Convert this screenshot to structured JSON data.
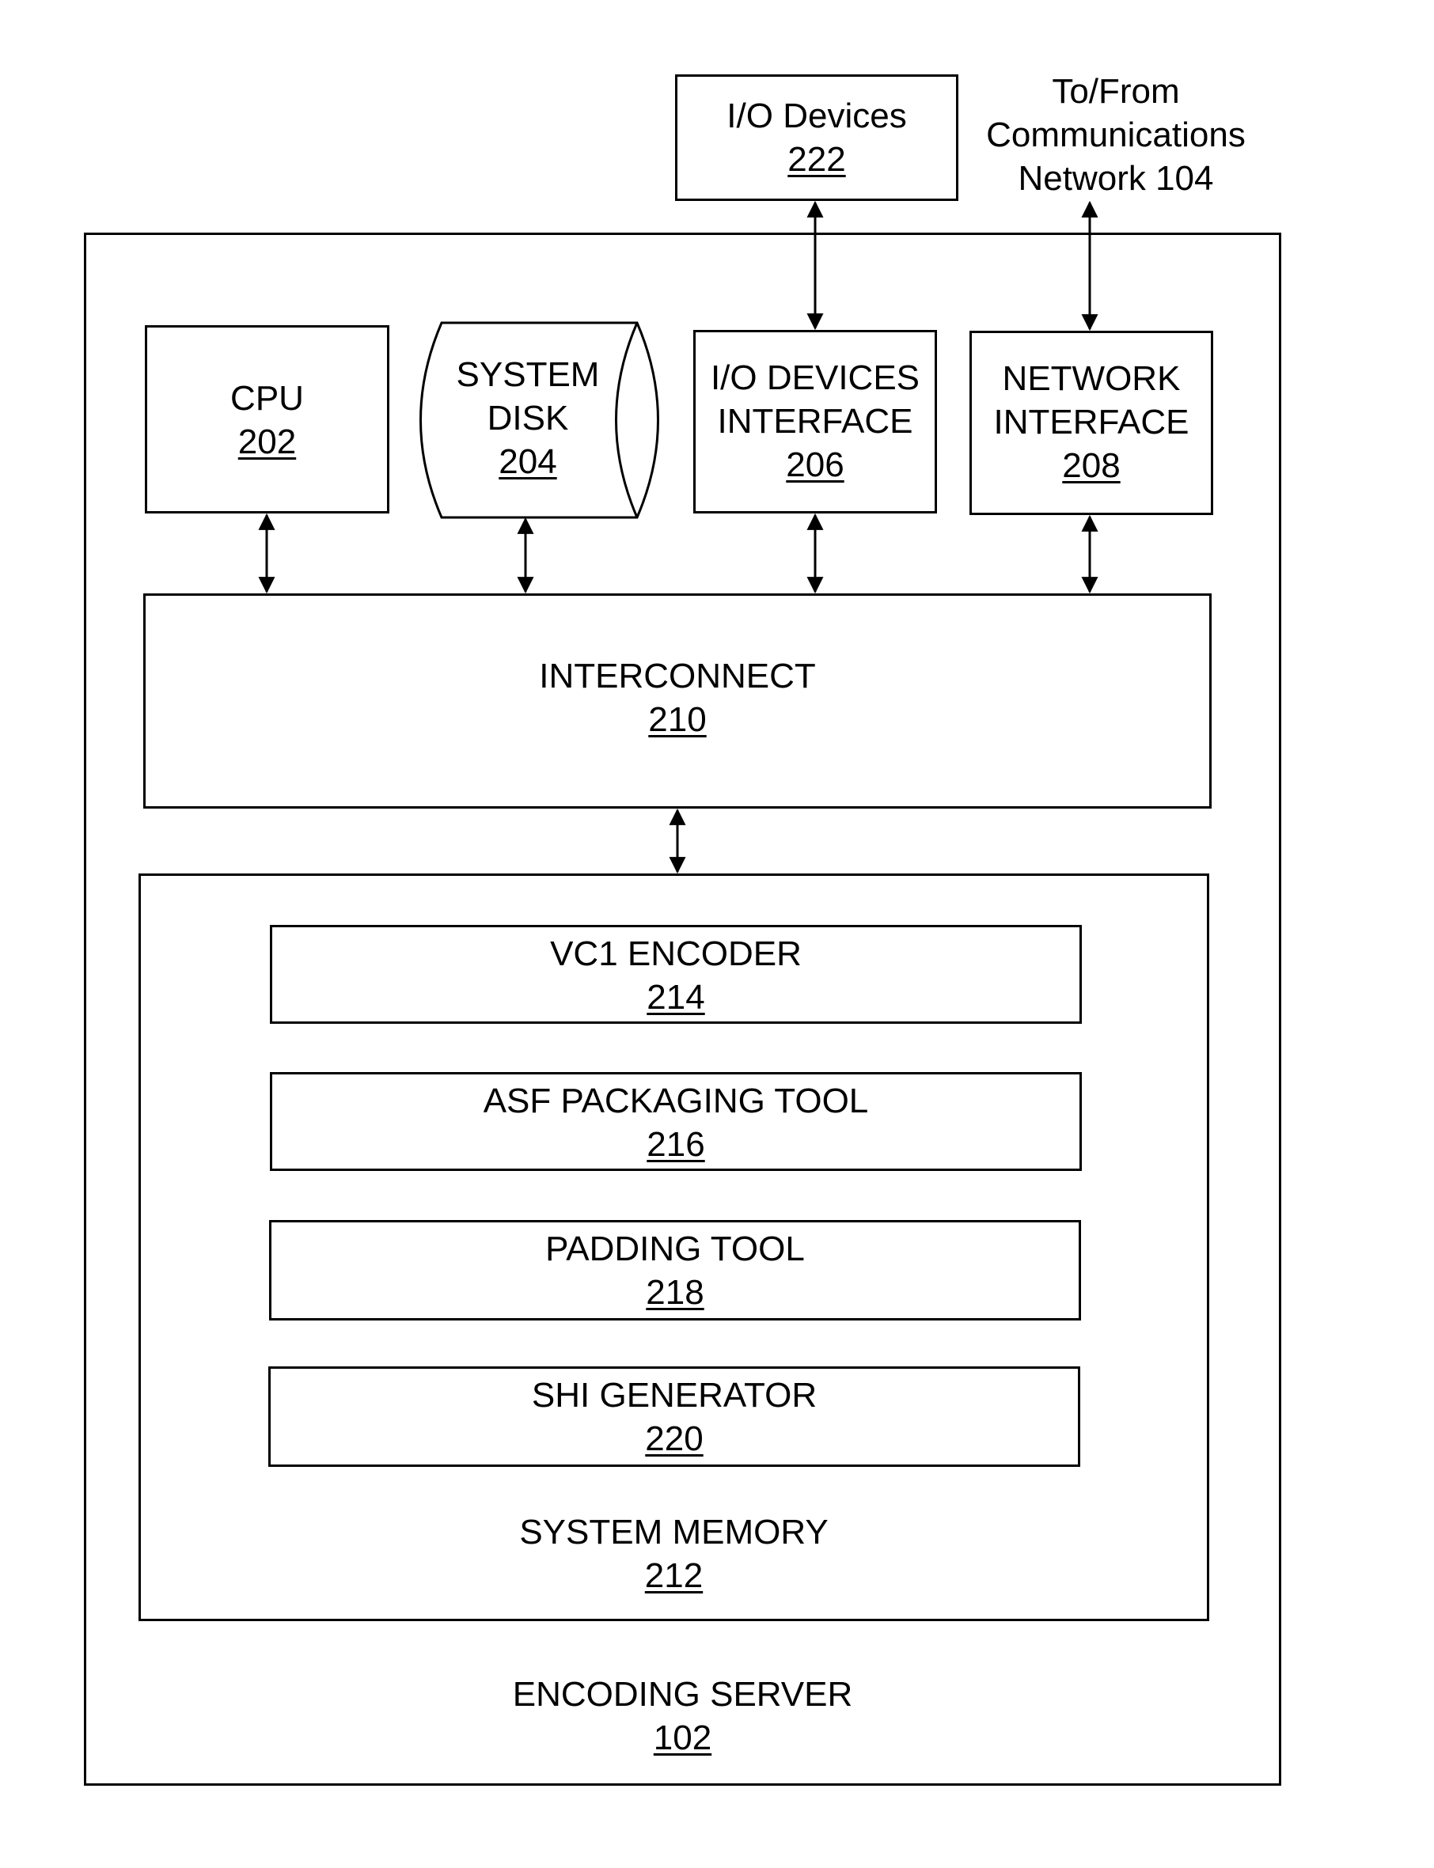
{
  "diagram": {
    "encoding_server": {
      "title": "ENCODING SERVER",
      "ref": "102"
    },
    "io_devices": {
      "title": "I/O Devices",
      "ref": "222"
    },
    "network_note": {
      "lines": [
        "To/From",
        "Communications",
        "Network 104"
      ]
    },
    "cpu": {
      "title": "CPU",
      "ref": "202"
    },
    "system_disk": {
      "lines": [
        "SYSTEM",
        "DISK"
      ],
      "ref": "204"
    },
    "io_interface": {
      "lines": [
        "I/O DEVICES",
        "INTERFACE"
      ],
      "ref": "206"
    },
    "network_interface": {
      "lines": [
        "NETWORK",
        "INTERFACE"
      ],
      "ref": "208"
    },
    "interconnect": {
      "title": "INTERCONNECT",
      "ref": "210"
    },
    "system_memory": {
      "title": "SYSTEM MEMORY",
      "ref": "212",
      "modules": [
        {
          "title": "VC1 ENCODER",
          "ref": "214"
        },
        {
          "title": "ASF PACKAGING TOOL",
          "ref": "216"
        },
        {
          "title": "PADDING TOOL",
          "ref": "218"
        },
        {
          "title": "SHI GENERATOR",
          "ref": "220"
        }
      ]
    },
    "connections": [
      {
        "from": "io_devices",
        "to": "io_interface",
        "type": "bidirectional"
      },
      {
        "from": "network_note",
        "to": "network_interface",
        "type": "bidirectional"
      },
      {
        "from": "cpu",
        "to": "interconnect",
        "type": "bidirectional"
      },
      {
        "from": "system_disk",
        "to": "interconnect",
        "type": "bidirectional"
      },
      {
        "from": "io_interface",
        "to": "interconnect",
        "type": "bidirectional"
      },
      {
        "from": "network_interface",
        "to": "interconnect",
        "type": "bidirectional"
      },
      {
        "from": "interconnect",
        "to": "system_memory",
        "type": "bidirectional"
      }
    ]
  }
}
